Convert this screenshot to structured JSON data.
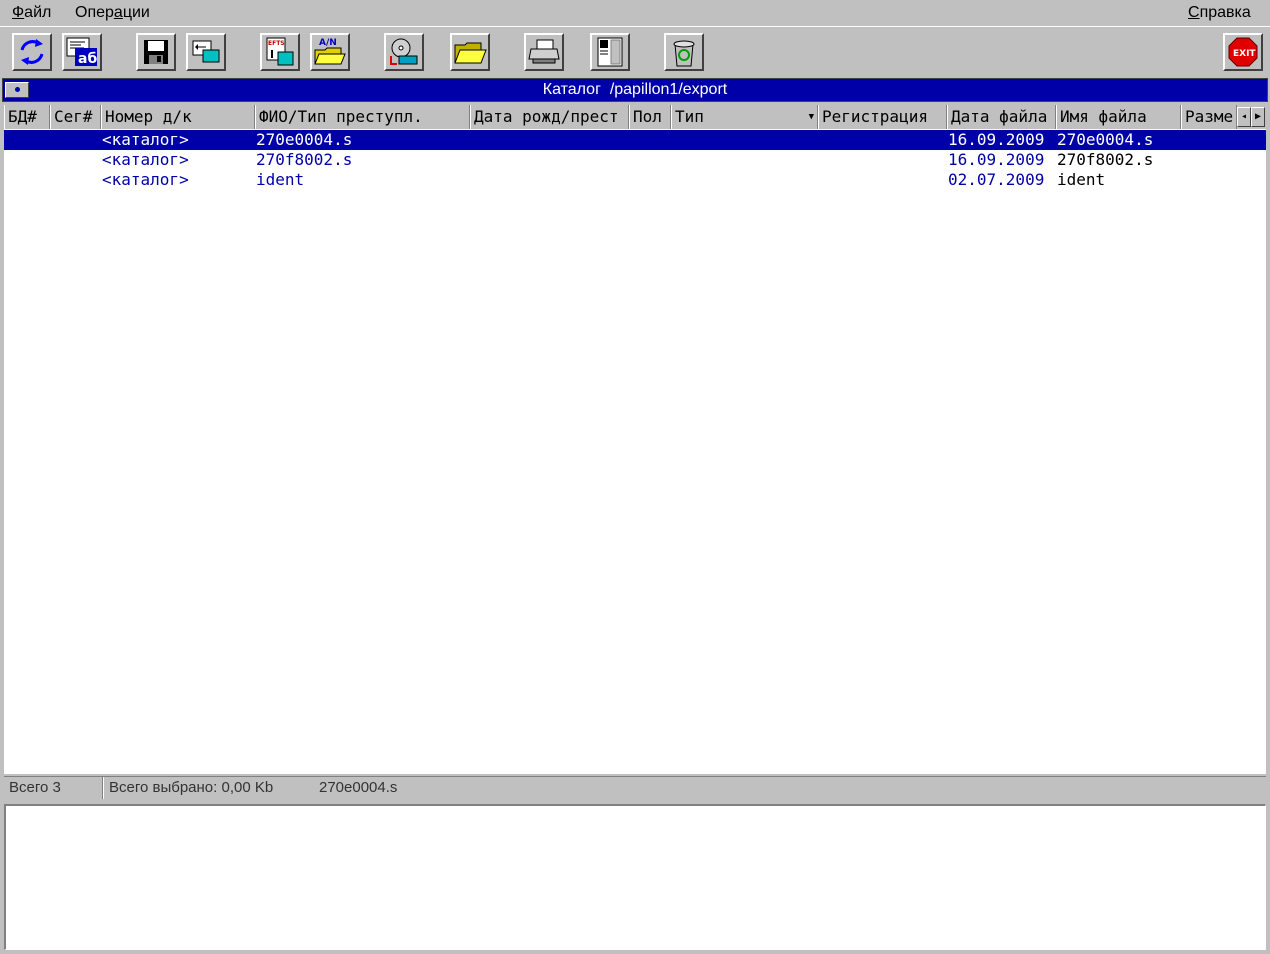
{
  "menu": {
    "file_accel": "Ф",
    "file_rest": "айл",
    "ops_pre": "Опер",
    "ops_accel": "а",
    "ops_rest": "ции",
    "help_accel": "С",
    "help_rest": "правка"
  },
  "toolbar": {
    "icons": [
      "refresh-icon",
      "ab-text-icon",
      "save-disk-icon",
      "transfer-icon",
      "efts-icon",
      "an-folder-icon",
      "cd-export-icon",
      "open-folder-icon",
      "print-icon",
      "columns-icon",
      "recycle-bin-icon",
      "exit-icon"
    ],
    "refresh_color": "#0000ff",
    "exit_color": "#e00000",
    "an_label": "A/N",
    "efts_label": "EFTS",
    "ab_label": "аб",
    "exit_label": "EXIT"
  },
  "catalog": {
    "label": "Каталог",
    "path": "/papillon1/export"
  },
  "columns": [
    "БД#",
    "Сег#",
    "Номер д/к",
    "ФИО/Тип преступл.",
    "Дата рожд/прест",
    "Пол",
    "Тип",
    "Регистрация",
    "Дата файла",
    "Имя файла",
    "Разме"
  ],
  "rows": [
    {
      "number": "<каталог>",
      "name": "270e0004.s",
      "file_date": "16.09.2009",
      "file_name": "270e0004.s",
      "selected": true
    },
    {
      "number": "<каталог>",
      "name": "270f8002.s",
      "file_date": "16.09.2009",
      "file_name": "270f8002.s",
      "selected": false
    },
    {
      "number": "<каталог>",
      "name": "ident",
      "file_date": "02.07.2009",
      "file_name": "ident",
      "selected": false
    }
  ],
  "status": {
    "total": "Всего 3",
    "selected": "Всего выбрано: 0,00 Kb",
    "current": "270e0004.s"
  },
  "colors": {
    "selection": "#0000a8",
    "chrome": "#c0c0c0"
  }
}
